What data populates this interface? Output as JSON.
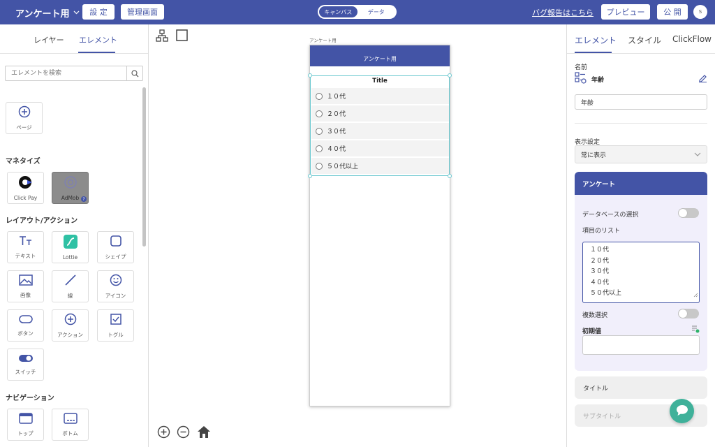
{
  "topbar": {
    "project_title": "アンケート用",
    "settings_label": "設 定",
    "admin_label": "管理画面",
    "mode_tabs": [
      {
        "label": "キャンバス",
        "active": true
      },
      {
        "label": "データ",
        "active": false
      }
    ],
    "bug_report_link": "バグ報告はこちら",
    "preview_label": "プレビュー",
    "publish_label": "公 開",
    "avatar_initial": "s",
    "accent_color": "#4354a6"
  },
  "left_panel": {
    "tabs": [
      {
        "label": "レイヤー",
        "active": false
      },
      {
        "label": "エレメント",
        "active": true
      }
    ],
    "search_placeholder": "エレメントを検索",
    "page_tile": {
      "label": "ページ",
      "icon": "plus-circle-icon"
    },
    "sections": [
      {
        "title": "マネタイズ",
        "items": [
          {
            "label": "Click Pay",
            "icon": "clickpay-logo-icon"
          },
          {
            "label": "AdMob",
            "icon": "admob-icon"
          }
        ]
      },
      {
        "title": "レイアウト/アクション",
        "items": [
          {
            "label": "テキスト",
            "icon": "text-icon"
          },
          {
            "label": "Lottie",
            "icon": "lottie-icon"
          },
          {
            "label": "シェイプ",
            "icon": "shape-icon"
          },
          {
            "label": "画像",
            "icon": "image-icon"
          },
          {
            "label": "線",
            "icon": "line-icon"
          },
          {
            "label": "アイコン",
            "icon": "smiley-icon"
          },
          {
            "label": "ボタン",
            "icon": "button-icon"
          },
          {
            "label": "アクション",
            "icon": "action-plus-icon"
          },
          {
            "label": "トグル",
            "icon": "toggle-check-icon"
          },
          {
            "label": "スイッチ",
            "icon": "switch-icon"
          }
        ]
      },
      {
        "title": "ナビゲーション",
        "items": [
          {
            "label": "トップ",
            "icon": "top-nav-icon"
          },
          {
            "label": "ボトム",
            "icon": "bottom-nav-icon"
          }
        ]
      }
    ]
  },
  "canvas": {
    "page_name": "アンケート用",
    "header_title": "アンケート用",
    "survey": {
      "title": "Title",
      "options": [
        "１０代",
        "２０代",
        "３０代",
        "４０代",
        "５０代以上"
      ]
    }
  },
  "right_panel": {
    "tabs": [
      {
        "label": "エレメント",
        "active": true
      },
      {
        "label": "スタイル",
        "active": false
      },
      {
        "label": "ClickFlow",
        "active": false
      }
    ],
    "name_label": "名前",
    "element_name": "年齢",
    "name_value": "年齢",
    "display_label": "表示設定",
    "display_value": "常に表示",
    "survey_section": {
      "title": "アンケート",
      "database_label": "データベースの選択",
      "database_enabled": false,
      "list_label": "項目のリスト",
      "list_items": [
        "１０代",
        "２０代",
        "３０代",
        "４０代",
        "５０代以上"
      ],
      "multi_label": "複数選択",
      "multi_enabled": false,
      "initial_label": "初期値",
      "initial_value": ""
    },
    "title_section": "タイトル",
    "subtitle_section": "サブタイトル"
  }
}
